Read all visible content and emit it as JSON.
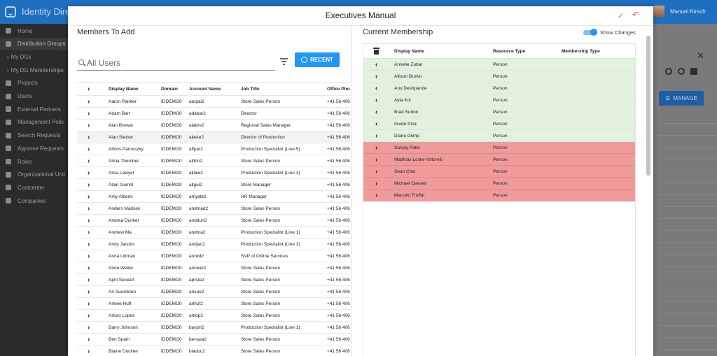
{
  "app": {
    "title": "Identity Dire",
    "user_name": "Manuel Kirsch"
  },
  "sidebar": {
    "items": [
      {
        "label": "Home",
        "icon": "home-icon",
        "sub": false
      },
      {
        "label": "Distribution Groups",
        "icon": "groups-icon",
        "sub": false,
        "active": true
      },
      {
        "label": "My DGs",
        "icon": "",
        "sub": true
      },
      {
        "label": "My DG Memberships",
        "icon": "",
        "sub": true
      },
      {
        "label": "Projects",
        "icon": "projects-icon",
        "sub": false
      },
      {
        "label": "Users",
        "icon": "user-icon",
        "sub": false
      },
      {
        "label": "External Partners",
        "icon": "partner-icon",
        "sub": false
      },
      {
        "label": "Management Polic",
        "icon": "policy-icon",
        "sub": false
      },
      {
        "label": "Search Requests",
        "icon": "search-requests-icon",
        "sub": false
      },
      {
        "label": "Approve Requests",
        "icon": "approve-icon",
        "sub": false
      },
      {
        "label": "Roles",
        "icon": "roles-icon",
        "sub": false
      },
      {
        "label": "Organizational Unit",
        "icon": "org-unit-icon",
        "sub": false
      },
      {
        "label": "Costcenter",
        "icon": "costcenter-icon",
        "sub": false
      },
      {
        "label": "Companies",
        "icon": "companies-icon",
        "sub": false
      }
    ]
  },
  "background": {
    "manage_label": "MANAGE"
  },
  "modal": {
    "title": "Executives Manual",
    "confirm_glyph": "✓",
    "undo_glyph": "↶"
  },
  "members_to_add": {
    "title": "Members To Add",
    "search_placeholder": "All Users",
    "recent_label": "RECENT",
    "columns": [
      "Display Name",
      "Domain",
      "Account Name",
      "Job Title",
      "Office Phor"
    ],
    "rows": [
      [
        "Aaron Painter",
        "IDDEMO0",
        "aarpai2",
        "Store Sales Person",
        "+41 56 406"
      ],
      [
        "Adam Barr",
        "IDDEMO0",
        "adabar2",
        "Director",
        "+41 56 406"
      ],
      [
        "Alan Brewer",
        "IDDEMO0",
        "alabre2",
        "Regional Sales Manager",
        "+41 56 406"
      ],
      [
        "Alan Steiner",
        "IDDEMO0",
        "alaste2",
        "Director of Production",
        "+41 56 406"
      ],
      [
        "Alfons Parovszky",
        "IDDEMO0",
        "alfpar2",
        "Production Spezialist (Line 5)",
        "+41 56 406"
      ],
      [
        "Alicia Thomber",
        "IDDEMO0",
        "alitho2",
        "Store Sales Person",
        "+41 56 406"
      ],
      [
        "Alisa Lawyer",
        "IDDEMO0",
        "alilaw2",
        "Production Spezialist (Line 3)",
        "+41 56 406"
      ],
      [
        "Allan Guinot",
        "IDDEMO0",
        "allgui2",
        "Store Manager",
        "+41 56 406"
      ],
      [
        "Amy Alberts",
        "IDDEMO0",
        "amyalb2",
        "HR Manager",
        "+41 56 406"
      ],
      [
        "Anders Madsen",
        "IDDEMO0",
        "andmad2",
        "Store Sales Person",
        "+41 56 406"
      ],
      [
        "Andrea Dunker",
        "IDDEMO0",
        "anddun2",
        "Store Sales Person",
        "+41 56 406"
      ],
      [
        "Andrew Ma",
        "IDDEMO0",
        "andma2",
        "Production Spezialist (Line 1)",
        "+41 56 406"
      ],
      [
        "Andy Jacobs",
        "IDDEMO0",
        "andjac2",
        "Production Spezialist (Line 3)",
        "+41 56 406"
      ],
      [
        "Anna Lidman",
        "IDDEMO0",
        "annlid2",
        "SVP of Online Services",
        "+41 56 406"
      ],
      [
        "Anne Weiler",
        "IDDEMO0",
        "annwei2",
        "Store Sales Person",
        "+41 56 406"
      ],
      [
        "April Stewart",
        "IDDEMO0",
        "aprste2",
        "Store Sales Person",
        "+41 56 406"
      ],
      [
        "Ari Suominen",
        "IDDEMO0",
        "arisuo2",
        "Store Sales Person",
        "+41 56 406"
      ],
      [
        "Arlene Huff",
        "IDDEMO0",
        "arlhuf2",
        "Store Sales Person",
        "+41 56 406"
      ],
      [
        "Arturo Lopez",
        "IDDEMO0",
        "artlop2",
        "Store Sales Person",
        "+41 56 406"
      ],
      [
        "Barry Johnson",
        "IDDEMO0",
        "barjoh2",
        "Production Spezialist (Line 1)",
        "+41 56 406"
      ],
      [
        "Ben Spain",
        "IDDEMO0",
        "benspa2",
        "Store Sales Person",
        "+41 56 406"
      ],
      [
        "Blaine Dockter",
        "IDDEMO0",
        "bladoc2",
        "Store Sales Person",
        "+41 56 406"
      ]
    ]
  },
  "current_membership": {
    "title": "Current Membership",
    "toggle_label": "Show Changes",
    "columns": [
      "Display Name",
      "Resource Type",
      "Membership Type"
    ],
    "rows": [
      {
        "name": "Annelie Zubar",
        "type": "Person",
        "membership": "",
        "status": "added"
      },
      {
        "name": "Allison Brown",
        "type": "Person",
        "membership": "",
        "status": "added"
      },
      {
        "name": "Anu Deshpande",
        "type": "Person",
        "membership": "",
        "status": "added"
      },
      {
        "name": "Ayla Kol",
        "type": "Person",
        "membership": "",
        "status": "added"
      },
      {
        "name": "Brad Sutton",
        "type": "Person",
        "membership": "",
        "status": "added"
      },
      {
        "name": "Guido Pica",
        "type": "Person",
        "membership": "",
        "status": "added"
      },
      {
        "name": "Diane Glimp",
        "type": "Person",
        "membership": "",
        "status": "added"
      },
      {
        "name": "Sanjay Patel",
        "type": "Person",
        "membership": "",
        "status": "removed"
      },
      {
        "name": "Matthias Loske-Vittorelli",
        "type": "Person",
        "membership": "",
        "status": "removed"
      },
      {
        "name": "Sean Chai",
        "type": "Person",
        "membership": "",
        "status": "removed"
      },
      {
        "name": "Michael Ovesen",
        "type": "Person",
        "membership": "",
        "status": "removed"
      },
      {
        "name": "Marcelo Truffat",
        "type": "Person",
        "membership": "",
        "status": "removed"
      }
    ]
  }
}
